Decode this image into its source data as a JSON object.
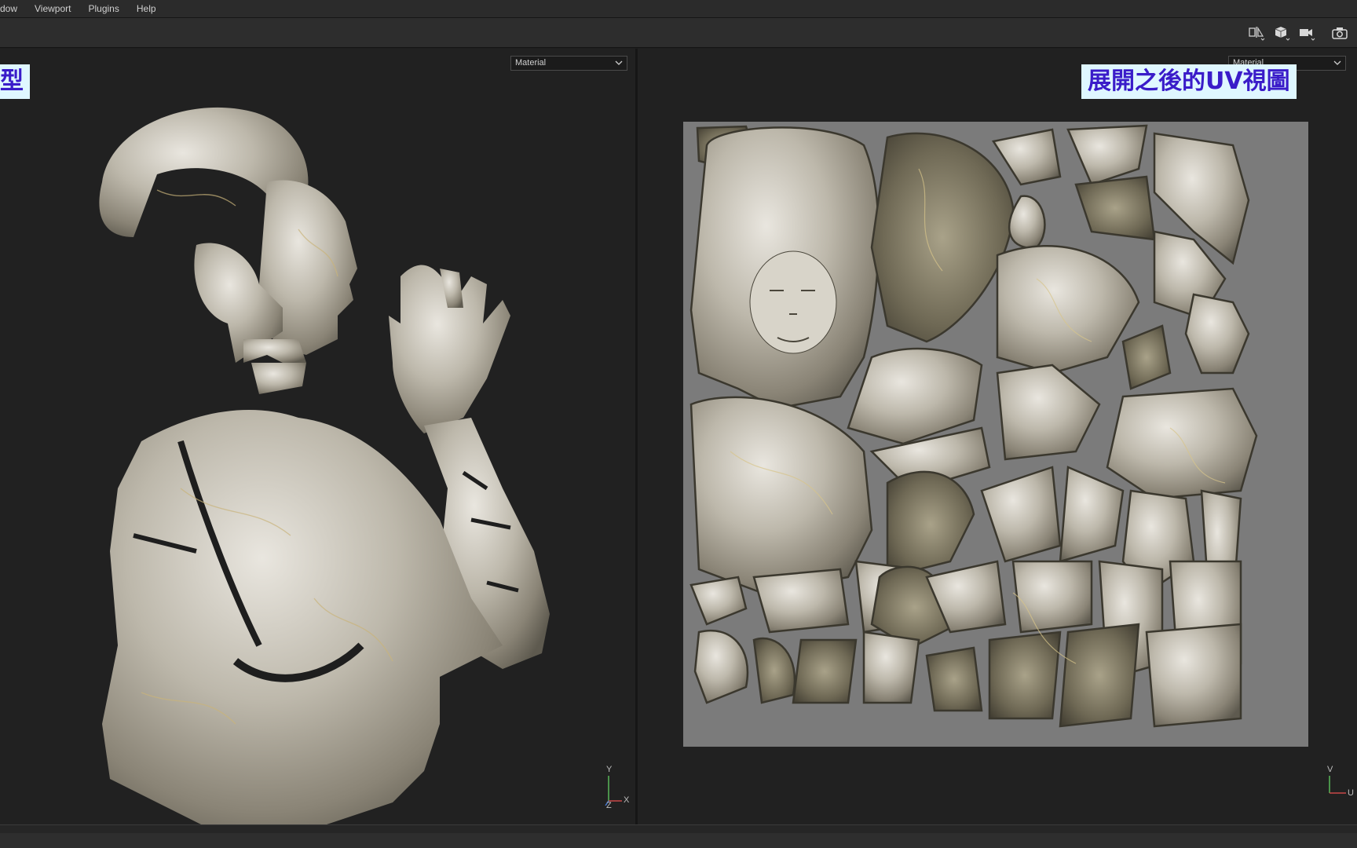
{
  "menubar": {
    "items": [
      {
        "label": "dow"
      },
      {
        "label": "Viewport"
      },
      {
        "label": "Plugins"
      },
      {
        "label": "Help"
      }
    ]
  },
  "toolbar": {
    "icons": [
      "split-view-icon",
      "cube-icon",
      "camera-icon",
      "screenshot-icon"
    ]
  },
  "left_viewport": {
    "shading_select": "Material",
    "caption": "型",
    "axis": {
      "y": "Y",
      "x": "X",
      "z": "Z"
    }
  },
  "right_viewport": {
    "shading_select": "Material",
    "caption": "展開之後的UV視圖",
    "axis": {
      "v": "V",
      "u": "U"
    }
  },
  "colors": {
    "caption_bg": "#dff7ff",
    "caption_text": "#3a1cc9",
    "uv_background": "#7b7b7b",
    "viewport_bg": "#212121"
  }
}
